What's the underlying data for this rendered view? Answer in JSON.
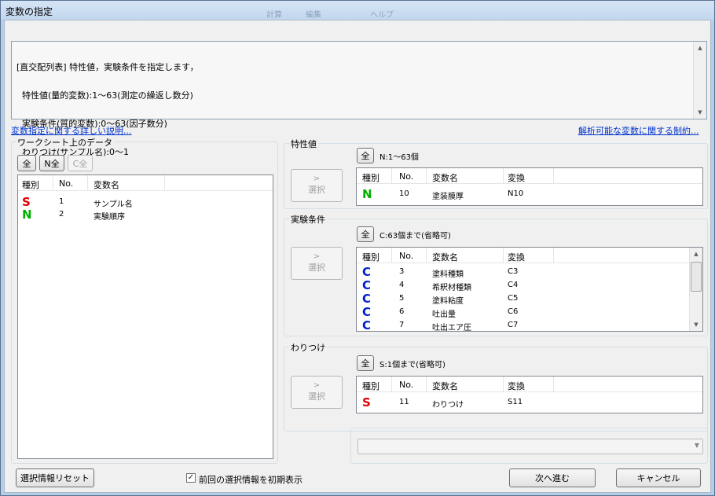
{
  "window": {
    "title": "変数の指定",
    "ghost_toolbar": [
      "計算",
      "編集",
      "ヘルプ"
    ]
  },
  "info": {
    "lines": [
      "[直交配列表] 特性値，実験条件を指定します，",
      "  特性値(量的変数):1～63(測定の繰返し数分)",
      "  実験条件(質的変数):0～63(因子数分)",
      "  わりつけ(サンプル名):0～1"
    ]
  },
  "links": {
    "detail": "変数指定に関する詳しい説明...",
    "limits": "解析可能な変数に関する制約..."
  },
  "worksheet": {
    "label": "ワークシート上のデータ",
    "buttons": {
      "all": "全",
      "n_all": "N全",
      "c_all": "C全"
    },
    "columns": [
      "種別",
      "No.",
      "変数名"
    ],
    "rows": [
      {
        "kind": "S",
        "no": "1",
        "name": "サンプル名"
      },
      {
        "kind": "N",
        "no": "2",
        "name": "実験順序"
      }
    ]
  },
  "select_label": "選択",
  "characteristic": {
    "label": "特性値",
    "all": "全",
    "desc": "N:1～63個",
    "columns": [
      "種別",
      "No.",
      "変数名",
      "変換"
    ],
    "rows": [
      {
        "kind": "N",
        "no": "10",
        "name": "塗装膜厚",
        "conv": "N10"
      }
    ]
  },
  "conditions": {
    "label": "実験条件",
    "all": "全",
    "desc": "C:63個まで(省略可)",
    "columns": [
      "種別",
      "No.",
      "変数名",
      "変換"
    ],
    "rows": [
      {
        "kind": "C",
        "no": "3",
        "name": "塗料種類",
        "conv": "C3"
      },
      {
        "kind": "C",
        "no": "4",
        "name": "希釈材種類",
        "conv": "C4"
      },
      {
        "kind": "C",
        "no": "5",
        "name": "塗料粘度",
        "conv": "C5"
      },
      {
        "kind": "C",
        "no": "6",
        "name": "吐出量",
        "conv": "C6"
      },
      {
        "kind": "C",
        "no": "7",
        "name": "吐出エア圧",
        "conv": "C7"
      }
    ]
  },
  "assignment": {
    "label": "わりつけ",
    "all": "全",
    "desc": "S:1個まで(省略可)",
    "columns": [
      "種別",
      "No.",
      "変数名",
      "変換"
    ],
    "rows": [
      {
        "kind": "S",
        "no": "11",
        "name": "わりつけ",
        "conv": "S11"
      }
    ]
  },
  "footer": {
    "reset": "選択情報リセット",
    "checkbox_label": "前回の選択情報を初期表示",
    "checkbox_checked": true,
    "next": "次へ進む",
    "cancel": "キャンセル",
    "combo_value": ""
  }
}
